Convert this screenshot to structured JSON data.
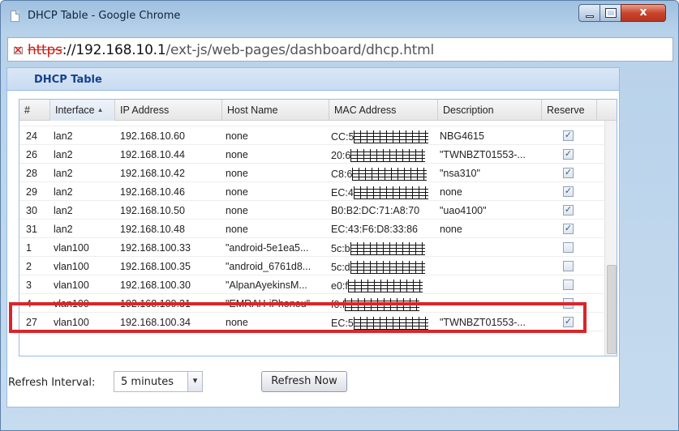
{
  "window": {
    "title": "DHCP Table - Google Chrome",
    "close_glyph": "x"
  },
  "address_bar": {
    "scheme": "https",
    "host": "://192.168.10.1",
    "path": "/ext-js/web-pages/dashboard/dhcp.html"
  },
  "panel": {
    "title": "DHCP Table"
  },
  "table": {
    "columns": {
      "num": "#",
      "interface": "Interface",
      "ip": "IP Address",
      "host": "Host Name",
      "mac": "MAC Address",
      "description": "Description",
      "reserve": "Reserve"
    },
    "rows": [
      {
        "num": "24",
        "interface": "lan2",
        "ip": "192.168.10.60",
        "host": "none",
        "mac_prefix": "CC:5",
        "mac_masked": true,
        "description": "NBG4615",
        "reserved": true
      },
      {
        "num": "26",
        "interface": "lan2",
        "ip": "192.168.10.44",
        "host": "none",
        "mac_prefix": "20:6",
        "mac_masked": true,
        "description": "\"TWNBZT01553-...",
        "reserved": true
      },
      {
        "num": "28",
        "interface": "lan2",
        "ip": "192.168.10.42",
        "host": "none",
        "mac_prefix": "C8:6",
        "mac_masked": true,
        "description": "\"nsa310\"",
        "reserved": true
      },
      {
        "num": "29",
        "interface": "lan2",
        "ip": "192.168.10.46",
        "host": "none",
        "mac_prefix": "EC:4",
        "mac_masked": true,
        "description": "none",
        "reserved": true
      },
      {
        "num": "30",
        "interface": "lan2",
        "ip": "192.168.10.50",
        "host": "none",
        "mac_prefix": "B0:B2:DC:71:A8:70",
        "mac_masked": false,
        "description": "\"uao4100\"",
        "reserved": true
      },
      {
        "num": "31",
        "interface": "lan2",
        "ip": "192.168.10.48",
        "host": "none",
        "mac_prefix": "EC:43:F6:D8:33:86",
        "mac_masked": false,
        "description": "none",
        "reserved": true
      },
      {
        "num": "1",
        "interface": "vlan100",
        "ip": "192.168.100.33",
        "host": "\"android-5e1ea5...",
        "mac_prefix": "5c:b",
        "mac_masked": true,
        "description": "",
        "reserved": false
      },
      {
        "num": "2",
        "interface": "vlan100",
        "ip": "192.168.100.35",
        "host": "\"android_6761d8...",
        "mac_prefix": "5c:d",
        "mac_masked": true,
        "description": "",
        "reserved": false
      },
      {
        "num": "3",
        "interface": "vlan100",
        "ip": "192.168.100.30",
        "host": "\"AlpanAyekinsM...",
        "mac_prefix": "e0:f",
        "mac_masked": true,
        "description": "",
        "reserved": false
      },
      {
        "num": "4",
        "interface": "vlan100",
        "ip": "192.168.100.31",
        "host": "\"EMRAH-iPhoneu\"",
        "mac_prefix": "f0:f",
        "mac_masked": true,
        "description": "",
        "reserved": false
      },
      {
        "num": "27",
        "interface": "vlan100",
        "ip": "192.168.100.34",
        "host": "none",
        "mac_prefix": "EC:5",
        "mac_masked": true,
        "description": "\"TWNBZT01553-...",
        "reserved": true
      }
    ]
  },
  "footer": {
    "refresh_label": "Refresh Interval:",
    "refresh_value": "5 minutes",
    "refresh_button": "Refresh Now"
  },
  "colors": {
    "highlight": "#d9262b",
    "panel_title": "#15428b",
    "struck_scheme": "#c8201a"
  },
  "icons": {
    "sort": "sort-ascending-icon",
    "checkbox": "checkbox-icon",
    "dropdown": "chevron-down-icon",
    "insecure": "insecure-lock-icon",
    "page": "page-icon"
  }
}
